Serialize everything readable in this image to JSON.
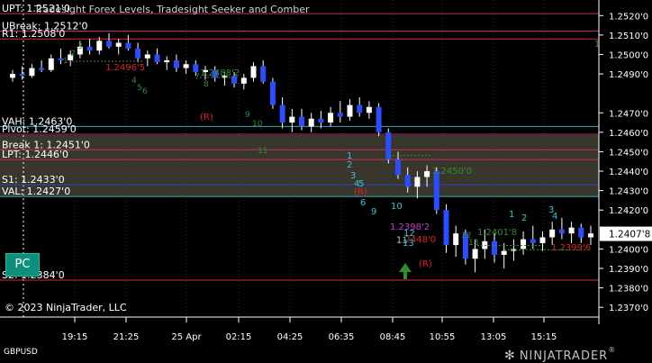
{
  "title": "Tradesight Forex Levels, Tradesight Seeker and Comber",
  "symbol": "GBPUSD",
  "copyright": "© 2023 NinjaTrader, LLC",
  "brand": "NINJATRADER",
  "brand_suffix": "®",
  "pc_button": "PC",
  "current_price": "1.2407'8",
  "colors": {
    "up": "#ffffff",
    "down": "#2a4dff",
    "wick": "#ffffff",
    "accent_green": "#2f8f2f",
    "accent_red": "#e02020",
    "cyan": "#2fc6d8",
    "magenta": "#c83bd6"
  },
  "chart_data": {
    "type": "candlestick",
    "title": "Tradesight Forex Levels, Tradesight Seeker and Comber",
    "ylim": [
      1.2365,
      1.2528
    ],
    "y_ticks": [
      "1.2520'0",
      "1.2510'0",
      "1.2500'0",
      "1.2490'0",
      "1.2470'0",
      "1.2460'0",
      "1.2450'0",
      "1.2440'0",
      "1.2430'0",
      "1.2420'0",
      "1.2400'0",
      "1.2390'0",
      "1.2380'0",
      "1.2370'0"
    ],
    "x_ticks": [
      "19:15",
      "21:25",
      "25 Apr",
      "02:15",
      "04:25",
      "06:35",
      "08:45",
      "10:55",
      "13:05",
      "15:15"
    ],
    "levels": [
      {
        "label": "UPT: 1.2521'0",
        "value": 1.2521,
        "color": "#c0306a"
      },
      {
        "label": "UBreak: 1.2512'0",
        "value": 1.2512,
        "color": "#c0306a"
      },
      {
        "label": "R1: 1.2508'0",
        "value": 1.2508,
        "color": "#d03030"
      },
      {
        "label": "VAH: 1.2463'0",
        "value": 1.2463,
        "color": "#2ab0c0"
      },
      {
        "label": "Pivot: 1.2459'0",
        "value": 1.2459,
        "color": "#c0306a"
      },
      {
        "label": "Break 1: 1.2451'0",
        "value": 1.2451,
        "color": "#c0306a"
      },
      {
        "label": "LPT: 1.2446'0",
        "value": 1.2446,
        "color": "#c0306a"
      },
      {
        "label": "S1: 1.2433'0",
        "value": 1.2433,
        "color": "#3040d0"
      },
      {
        "label": "VAL: 1.2427'0",
        "value": 1.2427,
        "color": "#2ab0c0"
      },
      {
        "label": "S2: 1.2384'0",
        "value": 1.2384,
        "color": "#d03030"
      }
    ],
    "extra_labels": [
      "1.2450'0",
      "1.2488'2",
      "1.2496'5",
      "1.2448'0",
      "1.2398'2",
      "1.2401'8",
      "1.2399'6",
      "1"
    ],
    "seeker_numbers": [
      "1",
      "2",
      "3",
      "4",
      "5",
      "6",
      "9",
      "10",
      "11",
      "12",
      "13",
      "1",
      "2",
      "3",
      "4"
    ],
    "comber_numbers": [
      "1",
      "2",
      "3",
      "4",
      "5",
      "6",
      "7",
      "8",
      "9",
      "10",
      "11",
      "12",
      "13"
    ],
    "signals": [
      "(R)",
      "(R)",
      "(R)"
    ],
    "candles": [
      [
        1.2488,
        1.2492,
        1.2486,
        1.249
      ],
      [
        1.249,
        1.2494,
        1.2487,
        1.2489
      ],
      [
        1.2489,
        1.2495,
        1.2488,
        1.2493
      ],
      [
        1.2493,
        1.2497,
        1.2491,
        1.2492
      ],
      [
        1.2492,
        1.25,
        1.2491,
        1.2498
      ],
      [
        1.2498,
        1.2503,
        1.2495,
        1.2497
      ],
      [
        1.2497,
        1.2502,
        1.2494,
        1.25
      ],
      [
        1.25,
        1.2507,
        1.2498,
        1.2504
      ],
      [
        1.2504,
        1.2508,
        1.25,
        1.2502
      ],
      [
        1.2502,
        1.2509,
        1.25,
        1.2507
      ],
      [
        1.2507,
        1.2511,
        1.2503,
        1.2504
      ],
      [
        1.2504,
        1.2508,
        1.25,
        1.2506
      ],
      [
        1.2506,
        1.251,
        1.2502,
        1.2503
      ],
      [
        1.2503,
        1.2506,
        1.2496,
        1.2498
      ],
      [
        1.2498,
        1.2502,
        1.2494,
        1.25
      ],
      [
        1.25,
        1.2503,
        1.2495,
        1.2496
      ],
      [
        1.2496,
        1.2499,
        1.2492,
        1.2497
      ],
      [
        1.2497,
        1.25,
        1.2491,
        1.2493
      ],
      [
        1.2493,
        1.2497,
        1.249,
        1.2495
      ],
      [
        1.2495,
        1.2497,
        1.2489,
        1.2491
      ],
      [
        1.2491,
        1.2494,
        1.2487,
        1.2492
      ],
      [
        1.2492,
        1.2494,
        1.2486,
        1.2488
      ],
      [
        1.2488,
        1.2491,
        1.2484,
        1.2489
      ],
      [
        1.2489,
        1.2491,
        1.2483,
        1.2485
      ],
      [
        1.2485,
        1.249,
        1.2482,
        1.2488
      ],
      [
        1.2488,
        1.2496,
        1.2486,
        1.2494
      ],
      [
        1.2494,
        1.2497,
        1.2485,
        1.2486
      ],
      [
        1.2486,
        1.2488,
        1.2472,
        1.2474
      ],
      [
        1.2474,
        1.2478,
        1.2462,
        1.2465
      ],
      [
        1.2465,
        1.2472,
        1.246,
        1.2468
      ],
      [
        1.2468,
        1.2472,
        1.2461,
        1.2463
      ],
      [
        1.2463,
        1.247,
        1.246,
        1.2467
      ],
      [
        1.2467,
        1.2471,
        1.2462,
        1.2465
      ],
      [
        1.2465,
        1.2473,
        1.2463,
        1.247
      ],
      [
        1.247,
        1.2476,
        1.2465,
        1.2468
      ],
      [
        1.2468,
        1.2477,
        1.2466,
        1.2474
      ],
      [
        1.2474,
        1.2478,
        1.2468,
        1.247
      ],
      [
        1.247,
        1.2476,
        1.2467,
        1.2473
      ],
      [
        1.2473,
        1.2475,
        1.2458,
        1.246
      ],
      [
        1.246,
        1.2462,
        1.2444,
        1.2446
      ],
      [
        1.2446,
        1.245,
        1.2436,
        1.2438
      ],
      [
        1.2438,
        1.2442,
        1.2429,
        1.2432
      ],
      [
        1.2432,
        1.244,
        1.2426,
        1.2437
      ],
      [
        1.2437,
        1.2443,
        1.2432,
        1.244
      ],
      [
        1.244,
        1.2442,
        1.2418,
        1.242
      ],
      [
        1.242,
        1.2423,
        1.2398,
        1.2402
      ],
      [
        1.2402,
        1.2412,
        1.2396,
        1.2408
      ],
      [
        1.2408,
        1.241,
        1.2392,
        1.2395
      ],
      [
        1.2395,
        1.2405,
        1.2388,
        1.24
      ],
      [
        1.24,
        1.241,
        1.2395,
        1.2404
      ],
      [
        1.2404,
        1.2408,
        1.2393,
        1.2397
      ],
      [
        1.2397,
        1.2403,
        1.239,
        1.2399
      ],
      [
        1.2399,
        1.2405,
        1.2394,
        1.24
      ],
      [
        1.24,
        1.2409,
        1.2397,
        1.2405
      ],
      [
        1.2405,
        1.2412,
        1.24,
        1.2403
      ],
      [
        1.2403,
        1.2409,
        1.2399,
        1.2406
      ],
      [
        1.2406,
        1.2414,
        1.2402,
        1.241
      ],
      [
        1.241,
        1.2416,
        1.2405,
        1.2408
      ],
      [
        1.2408,
        1.2414,
        1.2403,
        1.2411
      ],
      [
        1.2411,
        1.2413,
        1.2403,
        1.2406
      ],
      [
        1.2406,
        1.2412,
        1.2402,
        1.2408
      ]
    ]
  }
}
